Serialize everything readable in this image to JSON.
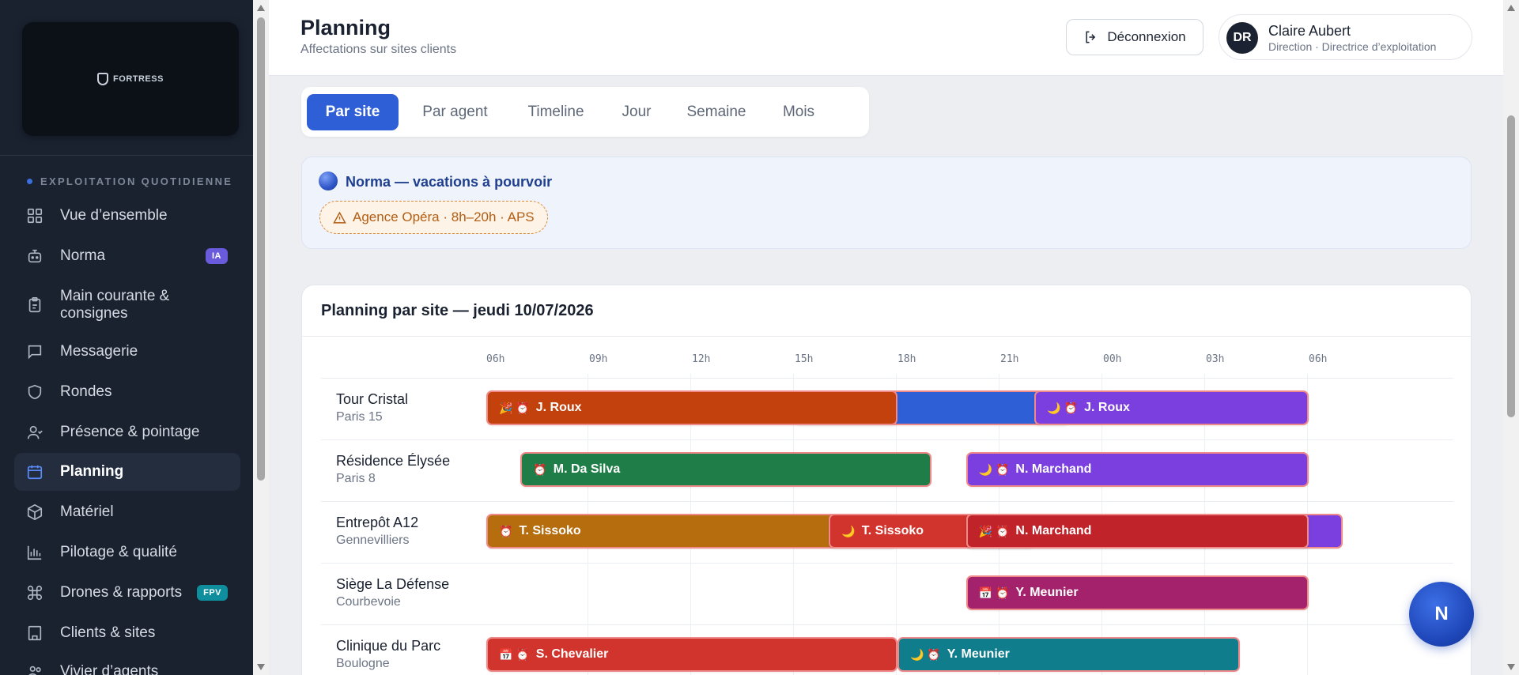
{
  "sidebar": {
    "logo_text": "FORTRESS",
    "section_label": "EXPLOITATION QUOTIDIENNE",
    "items": [
      {
        "label": "Vue d’ensemble",
        "icon": "grid-icon"
      },
      {
        "label": "Norma",
        "icon": "robot-icon",
        "badge": "IA"
      },
      {
        "label": "Main courante & consignes",
        "icon": "clipboard-icon"
      },
      {
        "label": "Messagerie",
        "icon": "message-icon"
      },
      {
        "label": "Rondes",
        "icon": "shield-icon"
      },
      {
        "label": "Présence & pointage",
        "icon": "users-icon"
      },
      {
        "label": "Planning",
        "icon": "calendar-icon",
        "active": true
      },
      {
        "label": "Matériel",
        "icon": "box-icon"
      },
      {
        "label": "Pilotage & qualité",
        "icon": "bar-chart-icon"
      },
      {
        "label": "Drones & rapports",
        "icon": "command-icon",
        "badge": "FPV"
      },
      {
        "label": "Clients & sites",
        "icon": "building-icon"
      },
      {
        "label": "Vivier d’agents",
        "icon": "people-icon"
      }
    ]
  },
  "header": {
    "title": "Planning",
    "subtitle": "Affectations sur sites clients",
    "logout_label": "Déconnexion",
    "user": {
      "initials": "DR",
      "name": "Claire Aubert",
      "role": "Direction · Directrice d’exploitation"
    }
  },
  "tabs": [
    "Par site",
    "Par agent",
    "Timeline",
    "Jour",
    "Semaine",
    "Mois"
  ],
  "active_tab": "Par site",
  "alert": {
    "title": "Norma — vacations à pourvoir",
    "chip": "Agence Opéra · 8h–20h · APS"
  },
  "planning": {
    "title": "Planning par site — jeudi 10/07/2026",
    "ticks": [
      "06h",
      "09h",
      "12h",
      "15h",
      "18h",
      "21h",
      "00h",
      "03h",
      "06h"
    ],
    "rows": [
      {
        "site": "Tour Cristal",
        "city": "Paris 15",
        "shifts": [
          {
            "agent": "",
            "start": "15h",
            "end": "23h",
            "color": "#2f5fd6",
            "glyphs": ""
          },
          {
            "agent": "J. Roux",
            "start": "06h",
            "end": "18h",
            "color": "#c2410c",
            "glyphs": "🎉 ⏰"
          },
          {
            "agent": "J. Roux",
            "start": "22h",
            "end": "06h",
            "color": "#7b3fe0",
            "glyphs": "🌙 ⏰"
          }
        ]
      },
      {
        "site": "Résidence Élysée",
        "city": "Paris 8",
        "shifts": [
          {
            "agent": "M. Da Silva",
            "start": "07h",
            "end": "19h",
            "color": "#1f7d47",
            "glyphs": "⏰"
          },
          {
            "agent": "N. Marchand",
            "start": "20h",
            "end": "06h",
            "color": "#7b3fe0",
            "glyphs": "🌙 ⏰"
          }
        ]
      },
      {
        "site": "Entrepôt A12",
        "city": "Gennevilliers",
        "shifts": [
          {
            "agent": "T. Sissoko",
            "start": "06h",
            "end": "18h",
            "color": "#b56d0e",
            "glyphs": "⏰"
          },
          {
            "agent": "T. Sissoko",
            "start": "16h",
            "end": "22h",
            "color": "#d0342c",
            "glyphs": "🌙"
          },
          {
            "agent": "",
            "start": "20h",
            "end": "07h",
            "color": "#7b3fe0",
            "glyphs": ""
          },
          {
            "agent": "N. Marchand",
            "start": "20h",
            "end": "06h",
            "color": "#c0232a",
            "glyphs": "🎉 ⏰"
          }
        ]
      },
      {
        "site": "Siège La Défense",
        "city": "Courbevoie",
        "shifts": [
          {
            "agent": "Y. Meunier",
            "start": "20h",
            "end": "06h",
            "color": "#a3226b",
            "glyphs": "📅 ⏰"
          }
        ]
      },
      {
        "site": "Clinique du Parc",
        "city": "Boulogne",
        "shifts": [
          {
            "agent": "S. Chevalier",
            "start": "06h",
            "end": "18h",
            "color": "#d0342c",
            "glyphs": "📅 ⏰"
          },
          {
            "agent": "Y. Meunier",
            "start": "18h",
            "end": "04h",
            "color": "#0f7d8c",
            "glyphs": "🌙 ⏰"
          }
        ]
      }
    ]
  },
  "fab_label": "N"
}
